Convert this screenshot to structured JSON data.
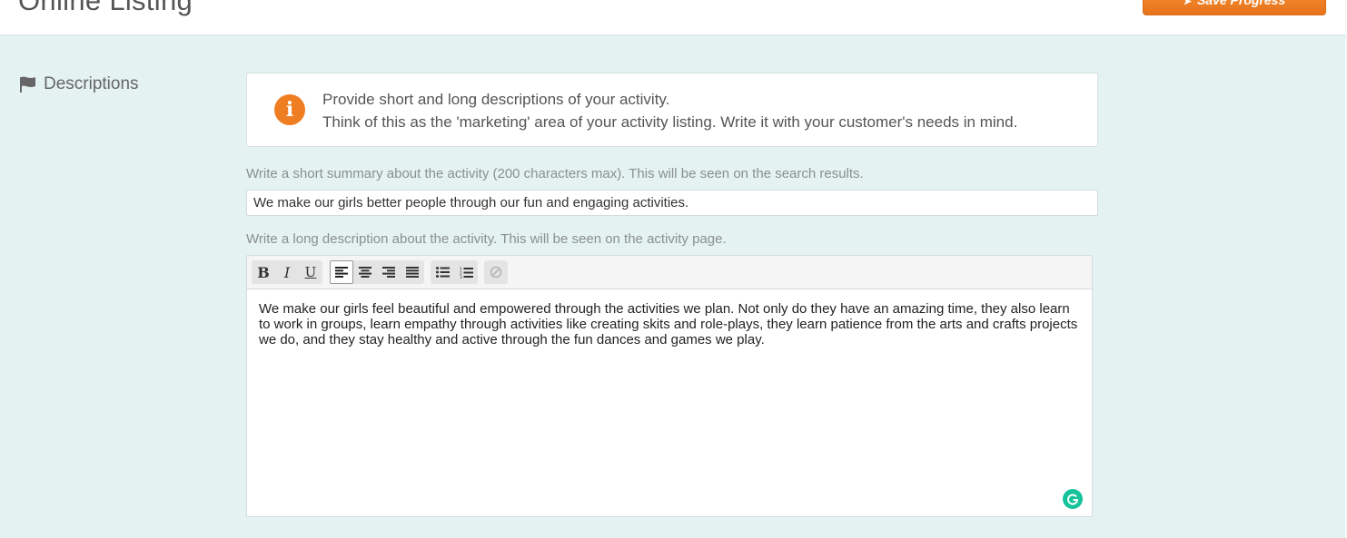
{
  "header": {
    "title": "Online Listing",
    "save_label": "Save Progress",
    "save_icon": "arrow-icon"
  },
  "section": {
    "label": "Descriptions",
    "icon": "flag-icon"
  },
  "info": {
    "icon": "info-icon",
    "line1": "Provide short and long descriptions of your activity.",
    "line2": "Think of this as the 'marketing' area of your activity listing. Write it with your customer's needs in mind."
  },
  "summary": {
    "label": "Write a short summary about the activity (200 characters max). This will be seen on the search results.",
    "value": "We make our girls better people through our fun and engaging activities."
  },
  "description": {
    "label": "Write a long description about the activity. This will be seen on the activity page.",
    "text": "We make our girls feel beautiful and empowered through the activities we plan. Not only do they have an amazing time, they also learn to work in groups, learn empathy through activities like creating skits and role-plays, they learn patience from the arts and crafts projects we do, and they stay healthy and active through the fun dances and games we play.",
    "toolbar": {
      "bold": "B",
      "italic": "I",
      "underline": "U"
    }
  },
  "colors": {
    "accent": "#ef7d22",
    "background": "#e4f2f2",
    "grammarly": "#15c39a"
  }
}
